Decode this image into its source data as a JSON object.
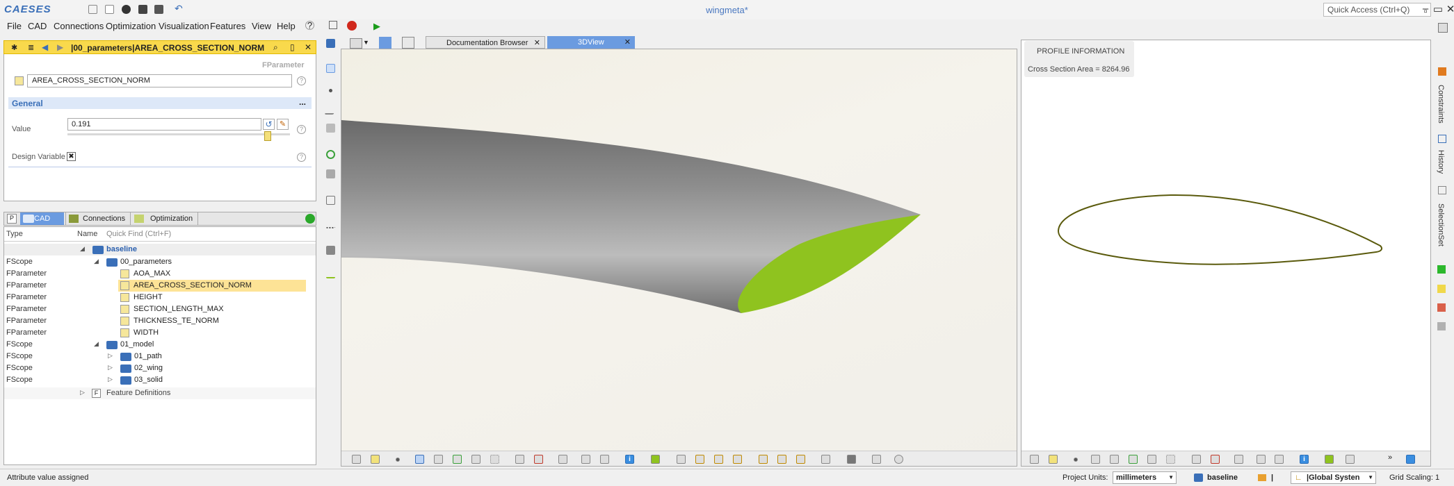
{
  "app": {
    "logo": "CAESES",
    "window_title": "wingmeta*",
    "quick_access_placeholder": "Quick Access (Ctrl+Q)"
  },
  "menu": [
    "File",
    "CAD",
    "Connections",
    "Optimization",
    "Visualization",
    "Features",
    "View",
    "Help"
  ],
  "param_panel": {
    "header": "|00_parameters|AREA_CROSS_SECTION_NORM",
    "type_label": "FParameter",
    "name_value": "AREA_CROSS_SECTION_NORM",
    "section_title": "General",
    "section_more": "...",
    "value_label": "Value",
    "value": "0.191",
    "design_variable_label": "Design Variable",
    "design_variable_mark": "✖"
  },
  "tree_panel": {
    "tabs": [
      "CAD",
      "Connections",
      "Optimization"
    ],
    "tab_p": "P",
    "col_type": "Type",
    "col_name": "Name",
    "quick_find": "Quick Find (Ctrl+F)",
    "rows": [
      {
        "type": "",
        "name": "baseline"
      },
      {
        "type": "FScope",
        "name": "00_parameters"
      },
      {
        "type": "FParameter",
        "name": "AOA_MAX"
      },
      {
        "type": "FParameter",
        "name": "AREA_CROSS_SECTION_NORM"
      },
      {
        "type": "FParameter",
        "name": "HEIGHT"
      },
      {
        "type": "FParameter",
        "name": "SECTION_LENGTH_MAX"
      },
      {
        "type": "FParameter",
        "name": "THICKNESS_TE_NORM"
      },
      {
        "type": "FParameter",
        "name": "WIDTH"
      },
      {
        "type": "FScope",
        "name": "01_model"
      },
      {
        "type": "FScope",
        "name": "01_path"
      },
      {
        "type": "FScope",
        "name": "02_wing"
      },
      {
        "type": "FScope",
        "name": "03_solid"
      },
      {
        "type": "",
        "name": "Feature Definitions"
      }
    ],
    "feature_icon": "F"
  },
  "view_tabs": [
    "Documentation Browser",
    "3DView"
  ],
  "profile_info": {
    "title": "PROFILE INFORMATION",
    "area": "Cross Section Area = 8264.96"
  },
  "right_sidebar": [
    "Constraints",
    "History",
    "SelectionSet"
  ],
  "status": {
    "message": "Attribute value assigned",
    "units_label": "Project Units:",
    "units_value": "millimeters",
    "scope": "baseline",
    "separator": "|",
    "system": "|Global Systen",
    "grid_scaling": "Grid Scaling: 1"
  },
  "colors": {
    "accent": "#3a6fb8",
    "wing_face": "#8fc31f",
    "selection": "#f9d94c",
    "profile_line": "#5a5a0c"
  }
}
